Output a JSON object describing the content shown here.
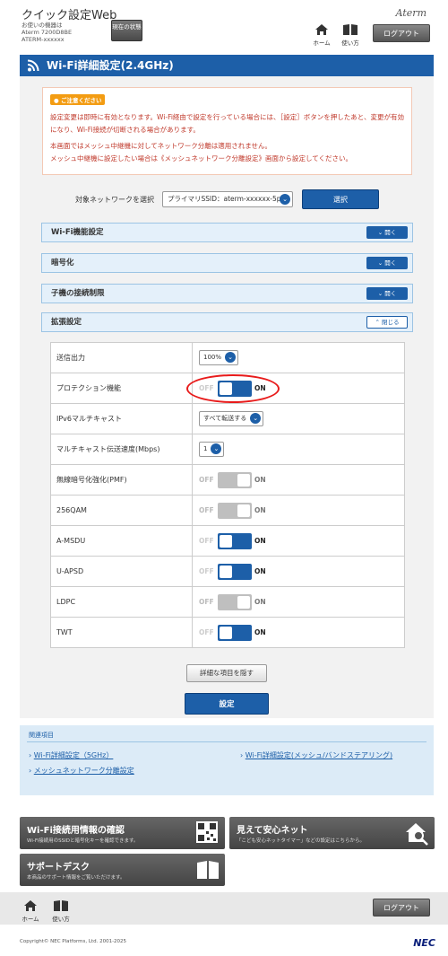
{
  "header": {
    "app_title": "クイック設定Web",
    "device_label": "お使いの機器は",
    "device_model": "Aterm 7200D8BE",
    "device_id": "ATERM-xxxxxx",
    "status_button": "現在の状態",
    "home_label": "ホーム",
    "help_label": "使い方",
    "brand": "Aterm",
    "logout": "ログアウト"
  },
  "page_title": "Wi-Fi詳細設定(2.4GHz)",
  "notice": {
    "badge": "ご注意ください",
    "line1": "設定変更は即時に有効となります。Wi-Fi経由で設定を行っている場合には、［設定］ボタンを押したあと、変更が有効になり、Wi-Fi接続が切断される場合があります。",
    "line2": "本画面ではメッシュ中継機に対してネットワーク分離は適用されません。",
    "line3": "メッシュ中継機に設定したい場合は《メッシュネットワーク分離設定》画面から設定してください。"
  },
  "network_select": {
    "label": "対象ネットワークを選択",
    "value": "プライマリSSID：aterm-xxxxxx-5p",
    "button": "選択"
  },
  "sections": [
    {
      "label": "Wi-Fi機能設定",
      "action": "開く"
    },
    {
      "label": "暗号化",
      "action": "開く"
    },
    {
      "label": "子機の接続制限",
      "action": "開く"
    },
    {
      "label": "拡張設定",
      "action": "閉じる"
    }
  ],
  "settings": {
    "tx_power": {
      "label": "送信出力",
      "value": "100%"
    },
    "protection": {
      "label": "プロテクション機能",
      "off": "OFF",
      "on": "ON",
      "state": "on"
    },
    "ipv6_multicast": {
      "label": "IPv6マルチキャスト",
      "value": "すべて転送する"
    },
    "multicast_rate": {
      "label": "マルチキャスト伝送速度(Mbps)",
      "value": "1"
    },
    "pmf": {
      "label": "無線暗号化強化(PMF)",
      "off": "OFF",
      "on": "ON",
      "state": "disabled"
    },
    "qam256": {
      "label": "256QAM",
      "off": "OFF",
      "on": "ON",
      "state": "disabled"
    },
    "amsdu": {
      "label": "A-MSDU",
      "off": "OFF",
      "on": "ON",
      "state": "on"
    },
    "uapsd": {
      "label": "U-APSD",
      "off": "OFF",
      "on": "ON",
      "state": "on"
    },
    "ldpc": {
      "label": "LDPC",
      "off": "OFF",
      "on": "ON",
      "state": "disabled"
    },
    "twt": {
      "label": "TWT",
      "off": "OFF",
      "on": "ON",
      "state": "on"
    }
  },
  "detail_button": "詳細な項目を隠す",
  "submit_button": "設定",
  "related": {
    "title": "関連項目",
    "link1": "Wi-Fi詳細設定（5GHz）",
    "link2": "メッシュネットワーク分離設定",
    "link3": "Wi-Fi詳細設定(メッシュ/バンドステアリング)"
  },
  "cards": {
    "wifi_info_title": "Wi-Fi接続用情報の確認",
    "wifi_info_sub": "Wi-Fi接続用のSSIDと暗号化キーを確認できます。",
    "safety_title": "見えて安心ネット",
    "safety_sub": "「こども安心ネットタイマー」などの設定はこちらから。",
    "support_title": "サポートデスク",
    "support_sub": "本商品のサポート情報をご覧いただけます。"
  },
  "footer": {
    "home_label": "ホーム",
    "help_label": "使い方",
    "logout": "ログアウト",
    "copyright": "Copyright© NEC Platforms, Ltd. 2001-2025",
    "brand": "NEC"
  },
  "colors": {
    "primary": "#1d5fa8",
    "notice_text": "#c0392b",
    "highlight": "#e81b1b"
  }
}
